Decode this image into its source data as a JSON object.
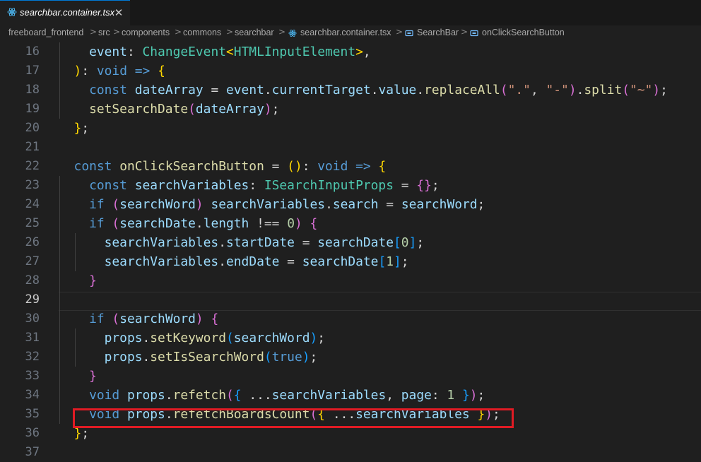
{
  "tab": {
    "filename": "searchbar.container.tsx",
    "close_glyph": "✕"
  },
  "breadcrumb": {
    "items": [
      "freeboard_frontend",
      "src",
      "components",
      "commons",
      "searchbar",
      "searchbar.container.tsx",
      "SearchBar",
      "onClickSearchButton"
    ],
    "separator": ">"
  },
  "editor": {
    "active_line": "29",
    "lines": [
      {
        "n": "16",
        "tokens": [
          [
            "    ",
            "p"
          ],
          [
            "event",
            "v"
          ],
          [
            ": ",
            "p"
          ],
          [
            "ChangeEvent",
            "t"
          ],
          [
            "<",
            "b"
          ],
          [
            "HTMLInputElement",
            "t"
          ],
          [
            ">",
            "b"
          ],
          [
            ",",
            "p"
          ]
        ]
      },
      {
        "n": "17",
        "tokens": [
          [
            "  ",
            "p"
          ],
          [
            ")",
            "b"
          ],
          [
            ": ",
            "p"
          ],
          [
            "void",
            "k"
          ],
          [
            " => ",
            "k"
          ],
          [
            "{",
            "b"
          ]
        ]
      },
      {
        "n": "18",
        "tokens": [
          [
            "    ",
            "p"
          ],
          [
            "const ",
            "k"
          ],
          [
            "dateArray",
            "v"
          ],
          [
            " = ",
            "p"
          ],
          [
            "event",
            "v"
          ],
          [
            ".",
            "p"
          ],
          [
            "currentTarget",
            "v"
          ],
          [
            ".",
            "p"
          ],
          [
            "value",
            "v"
          ],
          [
            ".",
            "p"
          ],
          [
            "replaceAll",
            "f"
          ],
          [
            "(",
            "b2"
          ],
          [
            "\".\"",
            "s"
          ],
          [
            ", ",
            "p"
          ],
          [
            "\"-\"",
            "s"
          ],
          [
            ")",
            "b2"
          ],
          [
            ".",
            "p"
          ],
          [
            "split",
            "f"
          ],
          [
            "(",
            "b2"
          ],
          [
            "\"~\"",
            "s"
          ],
          [
            ")",
            "b2"
          ],
          [
            ";",
            "p"
          ]
        ]
      },
      {
        "n": "19",
        "tokens": [
          [
            "    ",
            "p"
          ],
          [
            "setSearchDate",
            "f"
          ],
          [
            "(",
            "b2"
          ],
          [
            "dateArray",
            "v"
          ],
          [
            ")",
            "b2"
          ],
          [
            ";",
            "p"
          ]
        ]
      },
      {
        "n": "20",
        "tokens": [
          [
            "  ",
            "p"
          ],
          [
            "}",
            "b"
          ],
          [
            ";",
            "p"
          ]
        ]
      },
      {
        "n": "21",
        "tokens": []
      },
      {
        "n": "22",
        "tokens": [
          [
            "  ",
            "p"
          ],
          [
            "const ",
            "k"
          ],
          [
            "onClickSearchButton",
            "f"
          ],
          [
            " = ",
            "p"
          ],
          [
            "()",
            "b"
          ],
          [
            ": ",
            "p"
          ],
          [
            "void",
            "k"
          ],
          [
            " => ",
            "k"
          ],
          [
            "{",
            "b"
          ]
        ]
      },
      {
        "n": "23",
        "tokens": [
          [
            "    ",
            "p"
          ],
          [
            "const ",
            "k"
          ],
          [
            "searchVariables",
            "v"
          ],
          [
            ": ",
            "p"
          ],
          [
            "ISearchInputProps",
            "t"
          ],
          [
            " = ",
            "p"
          ],
          [
            "{}",
            "b2"
          ],
          [
            ";",
            "p"
          ]
        ]
      },
      {
        "n": "24",
        "tokens": [
          [
            "    ",
            "p"
          ],
          [
            "if ",
            "k"
          ],
          [
            "(",
            "b2"
          ],
          [
            "searchWord",
            "v"
          ],
          [
            ")",
            "b2"
          ],
          [
            " ",
            "p"
          ],
          [
            "searchVariables",
            "v"
          ],
          [
            ".",
            "p"
          ],
          [
            "search",
            "v"
          ],
          [
            " = ",
            "p"
          ],
          [
            "searchWord",
            "v"
          ],
          [
            ";",
            "p"
          ]
        ]
      },
      {
        "n": "25",
        "tokens": [
          [
            "    ",
            "p"
          ],
          [
            "if ",
            "k"
          ],
          [
            "(",
            "b2"
          ],
          [
            "searchDate",
            "v"
          ],
          [
            ".",
            "p"
          ],
          [
            "length",
            "v"
          ],
          [
            " !== ",
            "p"
          ],
          [
            "0",
            "n"
          ],
          [
            ")",
            "b2"
          ],
          [
            " ",
            "p"
          ],
          [
            "{",
            "b2"
          ]
        ]
      },
      {
        "n": "26",
        "tokens": [
          [
            "      ",
            "p"
          ],
          [
            "searchVariables",
            "v"
          ],
          [
            ".",
            "p"
          ],
          [
            "startDate",
            "v"
          ],
          [
            " = ",
            "p"
          ],
          [
            "searchDate",
            "v"
          ],
          [
            "[",
            "b3"
          ],
          [
            "0",
            "n"
          ],
          [
            "]",
            "b3"
          ],
          [
            ";",
            "p"
          ]
        ]
      },
      {
        "n": "27",
        "tokens": [
          [
            "      ",
            "p"
          ],
          [
            "searchVariables",
            "v"
          ],
          [
            ".",
            "p"
          ],
          [
            "endDate",
            "v"
          ],
          [
            " = ",
            "p"
          ],
          [
            "searchDate",
            "v"
          ],
          [
            "[",
            "b3"
          ],
          [
            "1",
            "n"
          ],
          [
            "]",
            "b3"
          ],
          [
            ";",
            "p"
          ]
        ]
      },
      {
        "n": "28",
        "tokens": [
          [
            "    ",
            "p"
          ],
          [
            "}",
            "b2"
          ]
        ]
      },
      {
        "n": "29",
        "tokens": []
      },
      {
        "n": "30",
        "tokens": [
          [
            "    ",
            "p"
          ],
          [
            "if ",
            "k"
          ],
          [
            "(",
            "b2"
          ],
          [
            "searchWord",
            "v"
          ],
          [
            ")",
            "b2"
          ],
          [
            " ",
            "p"
          ],
          [
            "{",
            "b2"
          ]
        ]
      },
      {
        "n": "31",
        "tokens": [
          [
            "      ",
            "p"
          ],
          [
            "props",
            "v"
          ],
          [
            ".",
            "p"
          ],
          [
            "setKeyword",
            "f"
          ],
          [
            "(",
            "b3"
          ],
          [
            "searchWord",
            "v"
          ],
          [
            ")",
            "b3"
          ],
          [
            ";",
            "p"
          ]
        ]
      },
      {
        "n": "32",
        "tokens": [
          [
            "      ",
            "p"
          ],
          [
            "props",
            "v"
          ],
          [
            ".",
            "p"
          ],
          [
            "setIsSearchWord",
            "f"
          ],
          [
            "(",
            "b3"
          ],
          [
            "true",
            "k"
          ],
          [
            ")",
            "b3"
          ],
          [
            ";",
            "p"
          ]
        ]
      },
      {
        "n": "33",
        "tokens": [
          [
            "    ",
            "p"
          ],
          [
            "}",
            "b2"
          ]
        ]
      },
      {
        "n": "34",
        "tokens": [
          [
            "    ",
            "p"
          ],
          [
            "void ",
            "k"
          ],
          [
            "props",
            "v"
          ],
          [
            ".",
            "p"
          ],
          [
            "refetch",
            "f"
          ],
          [
            "(",
            "b2"
          ],
          [
            "{ ",
            "b3"
          ],
          [
            "...",
            "p"
          ],
          [
            "searchVariables",
            "v"
          ],
          [
            ", ",
            "p"
          ],
          [
            "page",
            "v"
          ],
          [
            ": ",
            "p"
          ],
          [
            "1",
            "n"
          ],
          [
            " }",
            "b3"
          ],
          [
            ")",
            "b2"
          ],
          [
            ";",
            "p"
          ]
        ]
      },
      {
        "n": "35",
        "tokens": [
          [
            "    ",
            "p"
          ],
          [
            "void ",
            "k"
          ],
          [
            "props",
            "v"
          ],
          [
            ".",
            "p"
          ],
          [
            "refetchBoardsCount",
            "f"
          ],
          [
            "(",
            "b2"
          ],
          [
            "{ ",
            "b"
          ],
          [
            "...",
            "p"
          ],
          [
            "searchVariables",
            "v"
          ],
          [
            " }",
            "b"
          ],
          [
            ")",
            "b2"
          ],
          [
            ";",
            "p"
          ]
        ]
      },
      {
        "n": "36",
        "tokens": [
          [
            "  ",
            "p"
          ],
          [
            "}",
            "b"
          ],
          [
            ";",
            "p"
          ]
        ]
      },
      {
        "n": "37",
        "tokens": []
      }
    ]
  },
  "colors": {
    "p": "#d4d4d4",
    "k": "#569cd6",
    "v": "#9cdcfe",
    "f": "#dcdcaa",
    "t": "#4ec9b0",
    "s": "#ce9178",
    "n": "#b5cea8",
    "b": "#ffd700",
    "b2": "#da70d6",
    "b3": "#179fff",
    "highlight_box": "#e01b24"
  }
}
